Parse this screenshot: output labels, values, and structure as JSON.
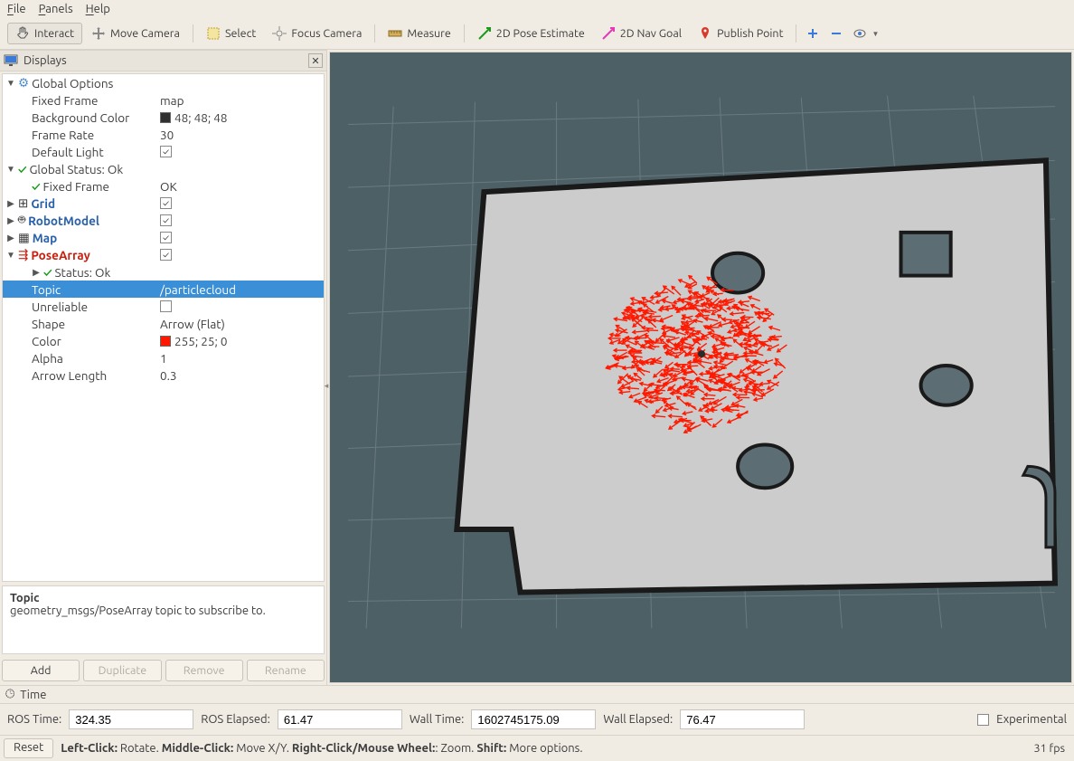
{
  "menu": {
    "file": "File",
    "panels": "Panels",
    "help": "Help"
  },
  "toolbar": {
    "interact": "Interact",
    "move_camera": "Move Camera",
    "select": "Select",
    "focus_camera": "Focus Camera",
    "measure": "Measure",
    "pose_estimate": "2D Pose Estimate",
    "nav_goal": "2D Nav Goal",
    "publish_point": "Publish Point"
  },
  "displays": {
    "title": "Displays",
    "global_options": "Global Options",
    "fixed_frame_label": "Fixed Frame",
    "fixed_frame_value": "map",
    "bg_label": "Background Color",
    "bg_value": "48; 48; 48",
    "frame_rate_label": "Frame Rate",
    "frame_rate_value": "30",
    "default_light_label": "Default Light",
    "global_status": "Global Status: Ok",
    "fixed_frame_status_label": "Fixed Frame",
    "fixed_frame_status_value": "OK",
    "grid": "Grid",
    "robotmodel": "RobotModel",
    "map": "Map",
    "posearray": "PoseArray",
    "status_ok": "Status: Ok",
    "topic_label": "Topic",
    "topic_value": "/particlecloud",
    "unreliable_label": "Unreliable",
    "shape_label": "Shape",
    "shape_value": "Arrow (Flat)",
    "color_label": "Color",
    "color_value": "255; 25; 0",
    "alpha_label": "Alpha",
    "alpha_value": "1",
    "arrow_len_label": "Arrow Length",
    "arrow_len_value": "0.3"
  },
  "desc": {
    "title": "Topic",
    "body": "geometry_msgs/PoseArray topic to subscribe to."
  },
  "buttons": {
    "add": "Add",
    "dup": "Duplicate",
    "remove": "Remove",
    "rename": "Rename"
  },
  "time": {
    "title": "Time",
    "ros_time_label": "ROS Time:",
    "ros_time": "324.35",
    "ros_elapsed_label": "ROS Elapsed:",
    "ros_elapsed": "61.47",
    "wall_time_label": "Wall Time:",
    "wall_time": "1602745175.09",
    "wall_elapsed_label": "Wall Elapsed:",
    "wall_elapsed": "76.47",
    "experimental": "Experimental"
  },
  "status": {
    "reset": "Reset",
    "hint_left": "Left-Click:",
    "hint_left_v": " Rotate. ",
    "hint_mid": "Middle-Click:",
    "hint_mid_v": " Move X/Y. ",
    "hint_right": "Right-Click/Mouse Wheel:",
    "hint_right_v": ": Zoom. ",
    "hint_shift": "Shift:",
    "hint_shift_v": " More options.",
    "fps": "31 fps"
  },
  "colors": {
    "bg_swatch": "#303030",
    "pose_color": "#ff1900"
  }
}
